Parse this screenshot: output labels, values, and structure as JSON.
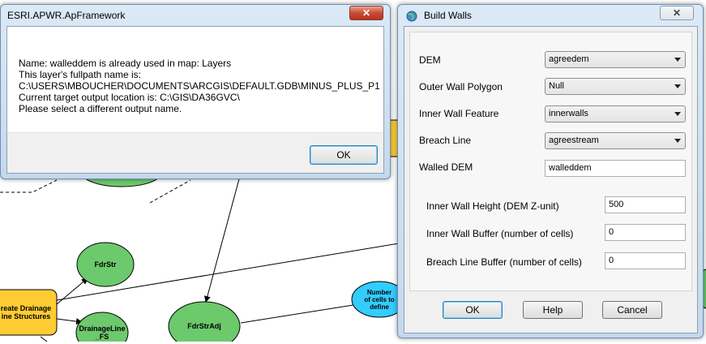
{
  "canvas": {
    "nodes": {
      "fdrstr": "FdrStr",
      "create_drainage": "reate Drainage\nine Structures",
      "drainage_fs": "DrainageLine\n_FS",
      "fdrstradj": "FdrStrAdj",
      "number_cells": "Number\nof cells to\ndefine"
    }
  },
  "message_dialog": {
    "title": "ESRI.APWR.ApFramework",
    "close_label": "✕",
    "lines": [
      "Name: walleddem is already used in map: Layers",
      "This layer's fullpath name is:",
      "C:\\USERS\\MBOUCHER\\DOCUMENTS\\ARCGIS\\DEFAULT.GDB\\MINUS_PLUS_P1",
      "Current target output location is: C:\\GIS\\DA36GVC\\",
      "Please select a different output name."
    ],
    "ok_label": "OK"
  },
  "build_walls": {
    "title": "Build Walls",
    "close_label": "✕",
    "fields": {
      "dem": {
        "label": "DEM",
        "value": "agreedem"
      },
      "outer_wall": {
        "label": "Outer Wall Polygon",
        "value": "Null"
      },
      "inner_wall_feature": {
        "label": "Inner Wall Feature",
        "value": "innerwalls"
      },
      "breach_line": {
        "label": "Breach Line",
        "value": "agreestream"
      },
      "walled_dem": {
        "label": "Walled DEM",
        "value": "walleddem"
      },
      "inner_wall_height": {
        "label": "Inner Wall Height (DEM Z-unit)",
        "value": "500"
      },
      "inner_wall_buffer": {
        "label": "Inner Wall Buffer (number of cells)",
        "value": "0"
      },
      "breach_line_buffer": {
        "label": "Breach Line Buffer (number of cells)",
        "value": "0"
      }
    },
    "buttons": {
      "ok": "OK",
      "help": "Help",
      "cancel": "Cancel"
    }
  },
  "colors": {
    "node_green": "#6cc96c",
    "node_yellow": "#ffcc33",
    "node_blue": "#33ccff",
    "close_red": "#c94b35"
  }
}
